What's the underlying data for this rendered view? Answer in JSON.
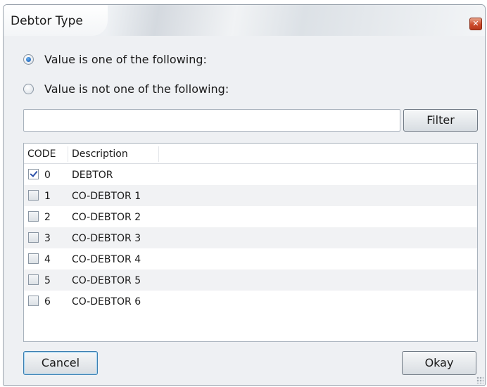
{
  "window": {
    "title": "Debtor Type",
    "close_symbol": "✕"
  },
  "options": {
    "include_label": "Value is one of the following:",
    "include_selected": true,
    "exclude_label": "Value is not one of the following:",
    "exclude_selected": false
  },
  "filter": {
    "input_value": "",
    "input_placeholder": "",
    "button_label": "Filter"
  },
  "grid": {
    "columns": [
      "CODE",
      "Description"
    ],
    "rows": [
      {
        "checked": true,
        "code": "0",
        "description": "DEBTOR"
      },
      {
        "checked": false,
        "code": "1",
        "description": "CO-DEBTOR 1"
      },
      {
        "checked": false,
        "code": "2",
        "description": "CO-DEBTOR 2"
      },
      {
        "checked": false,
        "code": "3",
        "description": "CO-DEBTOR 3"
      },
      {
        "checked": false,
        "code": "4",
        "description": "CO-DEBTOR 4"
      },
      {
        "checked": false,
        "code": "5",
        "description": "CO-DEBTOR 5"
      },
      {
        "checked": false,
        "code": "6",
        "description": "CO-DEBTOR 6"
      }
    ]
  },
  "buttons": {
    "cancel_label": "Cancel",
    "okay_label": "Okay"
  },
  "colors": {
    "accent": "#1e62b8",
    "close_button": "#cc4a2b"
  }
}
